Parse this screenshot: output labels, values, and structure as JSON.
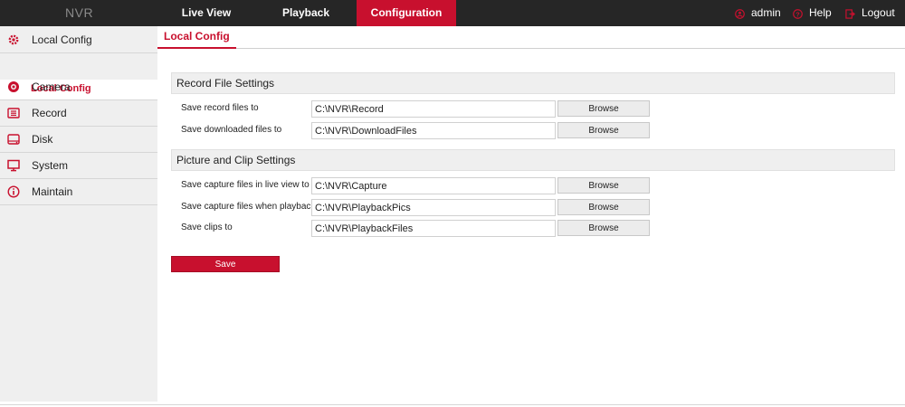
{
  "app": {
    "logo": "NVR"
  },
  "nav": {
    "tabs": [
      {
        "label": "Live View"
      },
      {
        "label": "Playback"
      },
      {
        "label": "Configuration",
        "active": true
      }
    ],
    "user": "admin",
    "help": "Help",
    "logout": "Logout"
  },
  "sidebar": {
    "items": [
      {
        "label": "Local Config",
        "icon": "gear-icon"
      },
      {
        "label": "Camera",
        "icon": "camera-icon"
      },
      {
        "label": "Record",
        "icon": "record-icon"
      },
      {
        "label": "Disk",
        "icon": "disk-icon"
      },
      {
        "label": "System",
        "icon": "monitor-icon"
      },
      {
        "label": "Maintain",
        "icon": "info-icon"
      }
    ],
    "sub_item": "Local Config"
  },
  "main": {
    "tab": "Local Config",
    "sections": [
      {
        "title": "Record File Settings",
        "rows": [
          {
            "label": "Save record files to",
            "value": "C:\\NVR\\Record",
            "button": "Browse"
          },
          {
            "label": "Save downloaded files to",
            "value": "C:\\NVR\\DownloadFiles",
            "button": "Browse"
          }
        ]
      },
      {
        "title": "Picture and Clip Settings",
        "rows": [
          {
            "label": "Save capture files in live view to",
            "value": "C:\\NVR\\Capture",
            "button": "Browse"
          },
          {
            "label": "Save capture files when playback to",
            "value": "C:\\NVR\\PlaybackPics",
            "button": "Browse"
          },
          {
            "label": "Save clips to",
            "value": "C:\\NVR\\PlaybackFiles",
            "button": "Browse"
          }
        ]
      }
    ],
    "save_label": "Save"
  },
  "colors": {
    "accent": "#c8102e",
    "topbar": "#262626",
    "sidebar": "#efefef"
  }
}
